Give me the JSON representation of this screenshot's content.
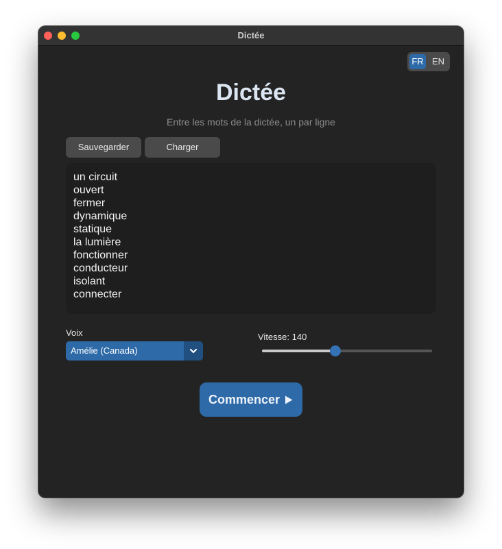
{
  "window": {
    "title": "Dictée"
  },
  "language": {
    "options": [
      "FR",
      "EN"
    ],
    "selected": "FR"
  },
  "main": {
    "heading": "Dictée",
    "subtitle": "Entre les mots de la dictée, un par ligne"
  },
  "toolbar": {
    "save_label": "Sauvegarder",
    "load_label": "Charger"
  },
  "words": {
    "text": "un circuit\nouvert\nfermer\ndynamique\nstatique\nla lumière\nfonctionner\nconducteur\nisolant\nconnecter"
  },
  "voice": {
    "label": "Voix",
    "selected": "Amélie (Canada)"
  },
  "speed": {
    "label": "Vitesse: 140",
    "value_fraction": 0.43
  },
  "start_button": {
    "label": "Commencer"
  },
  "icons": {
    "start": "play-icon",
    "dropdown": "chevron-down-icon"
  },
  "colors": {
    "accent": "#2e6aa8",
    "background": "#232323",
    "text_area": "#1e1e1e"
  }
}
